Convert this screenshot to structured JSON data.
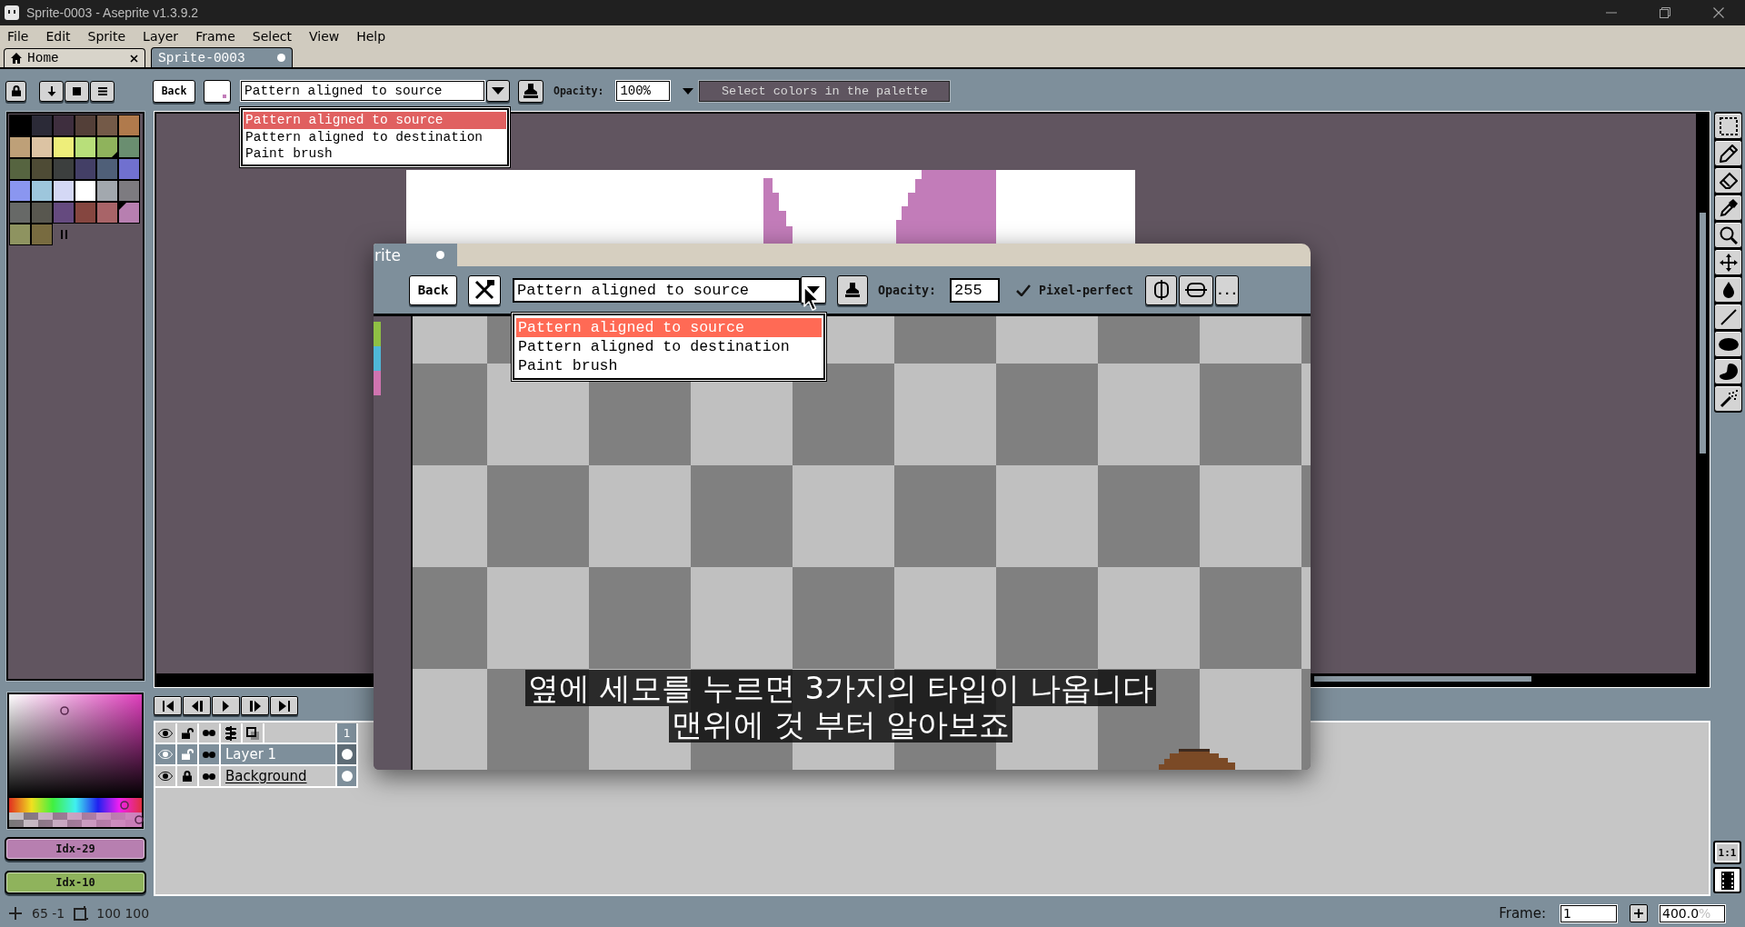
{
  "window": {
    "title": "Sprite-0003 - Aseprite v1.3.9.2"
  },
  "menu": [
    {
      "label": "File"
    },
    {
      "label": "Edit"
    },
    {
      "label": "Sprite"
    },
    {
      "label": "Layer"
    },
    {
      "label": "Frame"
    },
    {
      "label": "Select"
    },
    {
      "label": "View"
    },
    {
      "label": "Help"
    }
  ],
  "tabs": [
    {
      "label": "Home",
      "kind": "home",
      "selected": false,
      "modified": false
    },
    {
      "label": "Sprite-0003",
      "kind": "document",
      "selected": true,
      "modified": true
    }
  ],
  "toolbar": {
    "back": "Back",
    "ink_mode": {
      "value": "Pattern aligned to source",
      "expanded": true,
      "options": [
        {
          "label": "Pattern aligned to source",
          "selected": true
        },
        {
          "label": "Pattern aligned to destination",
          "selected": false
        },
        {
          "label": "Paint brush",
          "selected": false
        }
      ]
    },
    "opacity_label": "Opacity:",
    "opacity": "100%",
    "hint": "Select colors in the palette"
  },
  "palette": [
    {
      "color": "#000000",
      "foreground": false,
      "background": false
    },
    {
      "color": "#2b2a37",
      "foreground": false,
      "background": false
    },
    {
      "color": "#3e2e3e",
      "foreground": false,
      "background": false
    },
    {
      "color": "#533f38",
      "foreground": false,
      "background": false
    },
    {
      "color": "#745a48",
      "foreground": false,
      "background": false
    },
    {
      "color": "#b07a4c",
      "foreground": false,
      "background": false
    },
    {
      "color": "#bea078",
      "foreground": false,
      "background": false
    },
    {
      "color": "#dcc3a3",
      "foreground": false,
      "background": false
    },
    {
      "color": "#eeee7a",
      "foreground": false,
      "background": false
    },
    {
      "color": "#b8df7a",
      "foreground": false,
      "background": false
    },
    {
      "color": "#8fb35c",
      "foreground": false,
      "background": true
    },
    {
      "color": "#6a8e70",
      "foreground": false,
      "background": false
    },
    {
      "color": "#566440",
      "foreground": false,
      "background": false
    },
    {
      "color": "#4e4b35",
      "foreground": false,
      "background": false
    },
    {
      "color": "#3c3f3e",
      "foreground": false,
      "background": false
    },
    {
      "color": "#433f66",
      "foreground": false,
      "background": false
    },
    {
      "color": "#4f5f78",
      "foreground": false,
      "background": false
    },
    {
      "color": "#7070cf",
      "foreground": false,
      "background": false
    },
    {
      "color": "#8a96f0",
      "foreground": false,
      "background": false
    },
    {
      "color": "#9dc6dc",
      "foreground": false,
      "background": false
    },
    {
      "color": "#d4d8f5",
      "foreground": false,
      "background": false
    },
    {
      "color": "#ffffff",
      "foreground": false,
      "background": false
    },
    {
      "color": "#a2a8ae",
      "foreground": false,
      "background": false
    },
    {
      "color": "#7d7b80",
      "foreground": false,
      "background": false
    },
    {
      "color": "#676967",
      "foreground": false,
      "background": false
    },
    {
      "color": "#58574f",
      "foreground": false,
      "background": false
    },
    {
      "color": "#654a7f",
      "foreground": false,
      "background": false
    },
    {
      "color": "#854640",
      "foreground": false,
      "background": false
    },
    {
      "color": "#a86468",
      "foreground": false,
      "background": false
    },
    {
      "color": "#b77fb0",
      "foreground": true,
      "background": false
    },
    {
      "color": "#8e9360",
      "foreground": false,
      "background": false
    },
    {
      "color": "#786b40",
      "foreground": false,
      "background": false
    }
  ],
  "color_picker": {
    "saturation": {
      "level": 0.42
    },
    "brightness": {
      "level": 0.84
    },
    "hue": {
      "level": 0.87
    },
    "alpha": {
      "level": 0.98
    }
  },
  "color_buttons": [
    {
      "label": "Idx-29",
      "color": "#b77fb0"
    },
    {
      "label": "Idx-10",
      "color": "#8fb35c"
    }
  ],
  "timeline": {
    "frames": [
      {
        "label": "1",
        "selected": true
      }
    ],
    "layers": [
      {
        "name": "Layer 1",
        "kind": "layer",
        "selected": true,
        "visible": true,
        "locked": false
      },
      {
        "name": "Background",
        "kind": "background",
        "selected": false,
        "visible": true,
        "locked": true
      }
    ]
  },
  "status_bar": {
    "position": "65 -1",
    "size": "100 100",
    "frame_label": "Frame:",
    "frame": "1",
    "zoom": "400.0",
    "zoom_unit": "%"
  },
  "view_buttons": {
    "actual_size": "1:1"
  },
  "zoom_inset": {
    "tab": {
      "label": "rite",
      "modified": true
    },
    "back": "Back",
    "ink_mode": {
      "value": "Pattern aligned to source",
      "expanded": true,
      "options": [
        {
          "label": "Pattern aligned to source",
          "selected": true
        },
        {
          "label": "Pattern aligned to destination",
          "selected": false
        },
        {
          "label": "Paint brush",
          "selected": false
        }
      ]
    },
    "opacity_label": "Opacity:",
    "opacity": "255",
    "pixel_perfect": {
      "label": "Pixel-perfect",
      "checked": true
    },
    "more": "..."
  },
  "subtitles": [
    "옆에 세모를 누르면 3가지의 타입이 나옵니다",
    "맨위에 것 부터 알아보죠"
  ]
}
